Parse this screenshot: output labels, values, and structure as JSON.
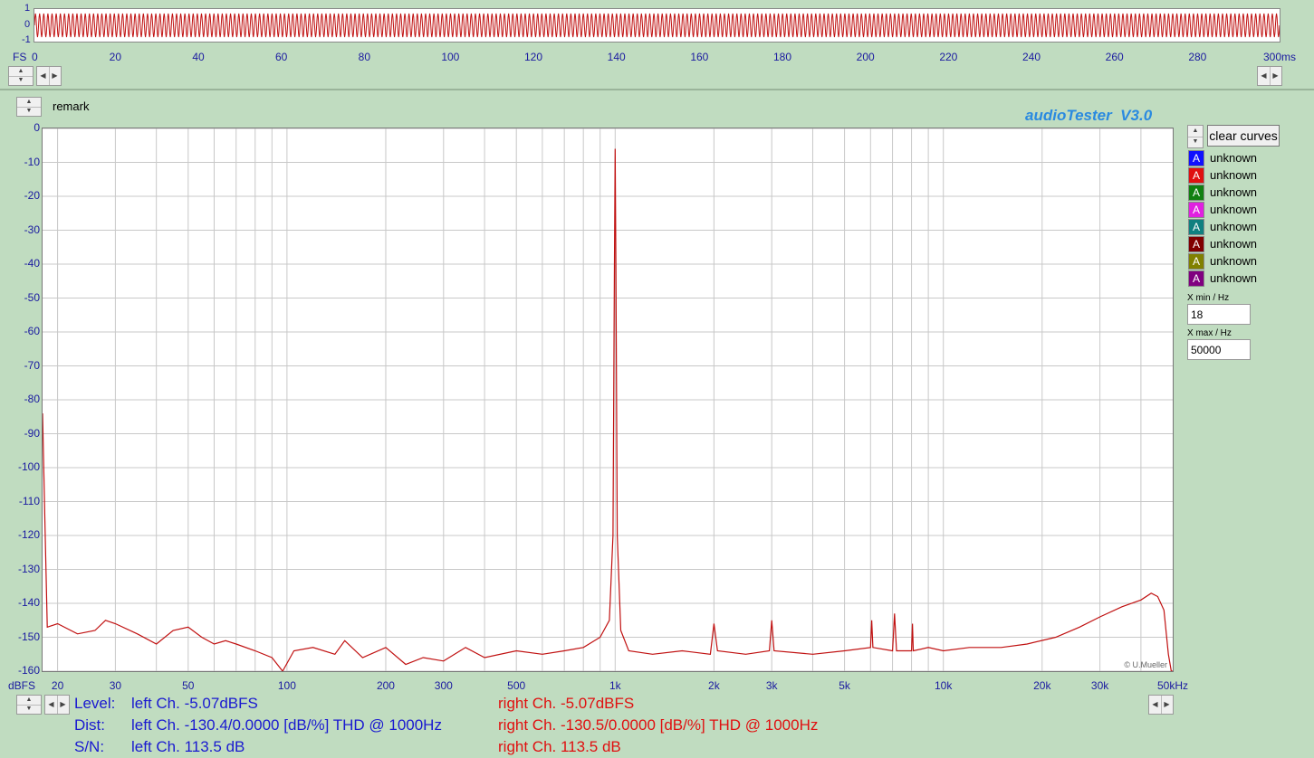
{
  "top": {
    "y_labels": [
      "1",
      "0",
      "-1"
    ],
    "fs_label": "FS",
    "x_ticks": [
      "0",
      "20",
      "40",
      "60",
      "80",
      "100",
      "120",
      "140",
      "160",
      "180",
      "200",
      "220",
      "240",
      "260",
      "280",
      "300ms"
    ],
    "waveform_color": "#c01010"
  },
  "remark_label": "remark",
  "brand": "audioTester  V3.0",
  "clear_button": "clear curves",
  "legend": [
    {
      "label": "unknown",
      "color": "#1010ff"
    },
    {
      "label": "unknown",
      "color": "#e01010"
    },
    {
      "label": "unknown",
      "color": "#108010"
    },
    {
      "label": "unknown",
      "color": "#e020e0"
    },
    {
      "label": "unknown",
      "color": "#108080"
    },
    {
      "label": "unknown",
      "color": "#800000"
    },
    {
      "label": "unknown",
      "color": "#808000"
    },
    {
      "label": "unknown",
      "color": "#800080"
    }
  ],
  "xmin": {
    "label": "X min / Hz",
    "value": "18"
  },
  "xmax": {
    "label": "X max / Hz",
    "value": "50000"
  },
  "copyright": "© U.Mueller",
  "y_unit": "dBFS",
  "chart_data": {
    "type": "line",
    "title": "",
    "xlabel": "",
    "ylabel": "dBFS",
    "x_scale": "log",
    "xlim": [
      18,
      50000
    ],
    "ylim": [
      -160,
      0
    ],
    "grid": true,
    "y_ticks": [
      "0",
      "-10",
      "-20",
      "-30",
      "-40",
      "-50",
      "-60",
      "-70",
      "-80",
      "-90",
      "-100",
      "-110",
      "-120",
      "-130",
      "-140",
      "-150",
      "-160"
    ],
    "x_ticks": [
      {
        "v": 20,
        "t": "20"
      },
      {
        "v": 30,
        "t": "30"
      },
      {
        "v": 50,
        "t": "50"
      },
      {
        "v": 100,
        "t": "100"
      },
      {
        "v": 200,
        "t": "200"
      },
      {
        "v": 300,
        "t": "300"
      },
      {
        "v": 500,
        "t": "500"
      },
      {
        "v": 1000,
        "t": "1k"
      },
      {
        "v": 2000,
        "t": "2k"
      },
      {
        "v": 3000,
        "t": "3k"
      },
      {
        "v": 5000,
        "t": "5k"
      },
      {
        "v": 10000,
        "t": "10k"
      },
      {
        "v": 20000,
        "t": "20k"
      },
      {
        "v": 30000,
        "t": "30k"
      },
      {
        "v": 50000,
        "t": "50kHz"
      }
    ],
    "series": [
      {
        "color": "#c01010",
        "points": [
          [
            18,
            -84
          ],
          [
            18.3,
            -116
          ],
          [
            18.6,
            -147
          ],
          [
            20,
            -146
          ],
          [
            23,
            -149
          ],
          [
            26,
            -148
          ],
          [
            28,
            -145
          ],
          [
            30,
            -146
          ],
          [
            35,
            -149
          ],
          [
            40,
            -152
          ],
          [
            45,
            -148
          ],
          [
            50,
            -147
          ],
          [
            55,
            -150
          ],
          [
            60,
            -152
          ],
          [
            65,
            -151
          ],
          [
            70,
            -152
          ],
          [
            80,
            -154
          ],
          [
            90,
            -156
          ],
          [
            97,
            -160
          ],
          [
            105,
            -154
          ],
          [
            120,
            -153
          ],
          [
            140,
            -155
          ],
          [
            150,
            -151
          ],
          [
            170,
            -156
          ],
          [
            200,
            -153
          ],
          [
            230,
            -158
          ],
          [
            260,
            -156
          ],
          [
            300,
            -157
          ],
          [
            350,
            -153
          ],
          [
            400,
            -156
          ],
          [
            500,
            -154
          ],
          [
            600,
            -155
          ],
          [
            700,
            -154
          ],
          [
            800,
            -153
          ],
          [
            900,
            -150
          ],
          [
            960,
            -145
          ],
          [
            985,
            -120
          ],
          [
            995,
            -40
          ],
          [
            1000,
            -6
          ],
          [
            1005,
            -40
          ],
          [
            1015,
            -120
          ],
          [
            1040,
            -148
          ],
          [
            1100,
            -154
          ],
          [
            1300,
            -155
          ],
          [
            1600,
            -154
          ],
          [
            1950,
            -155
          ],
          [
            2000,
            -146
          ],
          [
            2050,
            -154
          ],
          [
            2500,
            -155
          ],
          [
            2950,
            -154
          ],
          [
            3000,
            -145
          ],
          [
            3050,
            -154
          ],
          [
            4000,
            -155
          ],
          [
            5000,
            -154
          ],
          [
            6000,
            -153
          ],
          [
            6050,
            -145
          ],
          [
            6100,
            -153
          ],
          [
            7000,
            -154
          ],
          [
            7100,
            -143
          ],
          [
            7200,
            -154
          ],
          [
            8000,
            -154
          ],
          [
            8050,
            -146
          ],
          [
            8100,
            -154
          ],
          [
            9000,
            -153
          ],
          [
            10000,
            -154
          ],
          [
            12000,
            -153
          ],
          [
            15000,
            -153
          ],
          [
            18000,
            -152
          ],
          [
            22000,
            -150
          ],
          [
            26000,
            -147
          ],
          [
            30000,
            -144
          ],
          [
            35000,
            -141
          ],
          [
            40000,
            -139
          ],
          [
            43000,
            -137
          ],
          [
            45000,
            -138
          ],
          [
            47000,
            -142
          ],
          [
            48500,
            -155
          ],
          [
            49500,
            -160
          ],
          [
            50000,
            -160
          ]
        ]
      }
    ]
  },
  "info": {
    "level_label": "Level:",
    "dist_label": "Dist:",
    "sn_label": "S/N:",
    "left_level": "left Ch. -5.07dBFS",
    "left_dist": "left Ch. -130.4/0.0000 [dB/%] THD @ 1000Hz",
    "left_sn": "left Ch. 113.5 dB",
    "right_level": "right Ch. -5.07dBFS",
    "right_dist": "right Ch. -130.5/0.0000 [dB/%] THD @ 1000Hz",
    "right_sn": "right Ch. 113.5 dB"
  }
}
